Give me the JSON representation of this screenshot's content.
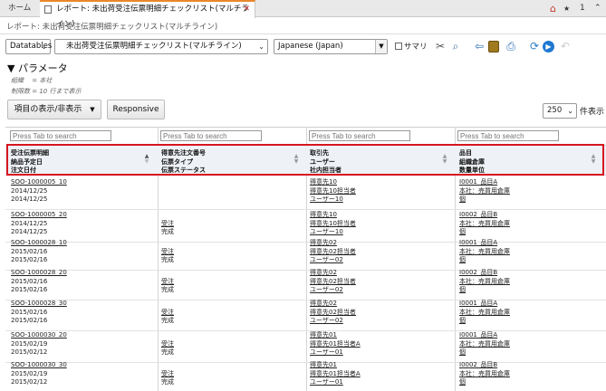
{
  "tabs": {
    "home": "ホーム",
    "report": "レポート: 未出荷受注伝票明細チェックリスト(マルチライン)",
    "count": "1"
  },
  "breadcrumb": "レポート: 未出荷受注伝票明細チェックリスト(マルチライン)",
  "toolbar": {
    "mode": "Datatables",
    "report_select": "未出荷受注伝票明細チェックリスト(マルチライン)",
    "language": "Japanese (Japan)",
    "summary_label": "サマリ"
  },
  "params": {
    "title": "▼ パラメータ",
    "line1": "組織　 = 本社",
    "line2": "制限数 = 10 行まで表示"
  },
  "buttons": {
    "columns": "項目の表示/非表示",
    "responsive": "Responsive"
  },
  "paging": {
    "size": "250",
    "label": "件表示"
  },
  "search_placeholder": "Press Tab to search",
  "headers": [
    {
      "l1": "受注伝票明細",
      "l2": "納品予定日",
      "l3": "注文日付"
    },
    {
      "l1": "得意先注文番号",
      "l2": "伝票タイプ",
      "l3": "伝票ステータス"
    },
    {
      "l1": "取引先",
      "l2": "ユーザー",
      "l3": "社内担当者"
    },
    {
      "l1": "品目",
      "l2": "組織倉庫",
      "l3": "数量単位"
    }
  ],
  "rows": [
    {
      "c1": [
        "SOO-1000005_10",
        "2014/12/25",
        "2014/12/25"
      ],
      "c2": [
        "",
        "",
        ""
      ],
      "c3": [
        "得意先10",
        "得意先10担当者",
        "ユーザー10"
      ],
      "c4": [
        "I0001_品目A",
        "本社：売買用倉庫",
        "個"
      ]
    },
    {
      "c1": [
        "SOO-1000005_20",
        "2014/12/25",
        "2014/12/25"
      ],
      "c2": [
        "",
        "受注",
        "完成"
      ],
      "c3": [
        "得意先10",
        "得意先10担当者",
        "ユーザー10"
      ],
      "c4": [
        "I0002_品目B",
        "本社：売買用倉庫",
        "個"
      ]
    },
    {
      "c1": [
        "SOO-1000028_10",
        "2015/02/16",
        "2015/02/16"
      ],
      "c2": [
        "",
        "受注",
        "完成"
      ],
      "c3": [
        "得意先02",
        "得意先02担当者",
        "ユーザー02"
      ],
      "c4": [
        "I0001_品目A",
        "本社：売買用倉庫",
        "個"
      ]
    },
    {
      "c1": [
        "SOO-1000028_20",
        "2015/02/16",
        "2015/02/16"
      ],
      "c2": [
        "",
        "受注",
        "完成"
      ],
      "c3": [
        "得意先02",
        "得意先02担当者",
        "ユーザー02"
      ],
      "c4": [
        "I0002_品目B",
        "本社：売買用倉庫",
        "個"
      ]
    },
    {
      "c1": [
        "SOO-1000028_30",
        "2015/02/16",
        "2015/02/16"
      ],
      "c2": [
        "",
        "受注",
        "完成"
      ],
      "c3": [
        "得意先02",
        "得意先02担当者",
        "ユーザー02"
      ],
      "c4": [
        "I0001_品目A",
        "本社：売買用倉庫",
        "個"
      ]
    },
    {
      "c1": [
        "SOO-1000030_20",
        "2015/02/19",
        "2015/02/12"
      ],
      "c2": [
        "",
        "受注",
        "完成"
      ],
      "c3": [
        "得意先01",
        "得意先01担当者A",
        "ユーザー01"
      ],
      "c4": [
        "I0001_品目A",
        "本社：売買用倉庫",
        "個"
      ]
    },
    {
      "c1": [
        "SOO-1000030_30",
        "2015/02/19",
        "2015/02/12"
      ],
      "c2": [
        "",
        "受注",
        "完成"
      ],
      "c3": [
        "得意先01",
        "得意先01担当者A",
        "ユーザー01"
      ],
      "c4": [
        "I0002_品目B",
        "本社：売買用倉庫",
        "個"
      ]
    }
  ],
  "colors": {
    "accent_tab": "#e8872a",
    "highlight": "#d7161f",
    "header_bg": "#eef1f6"
  },
  "icons": {
    "home": "home-icon",
    "star": "star-icon",
    "chevron": "chevron-up-icon",
    "scissors": "scissors-icon",
    "search": "search-icon",
    "export": "export-icon",
    "save": "save-icon",
    "print": "print-icon",
    "refresh": "refresh-icon",
    "run": "run-icon",
    "back": "back-icon"
  }
}
